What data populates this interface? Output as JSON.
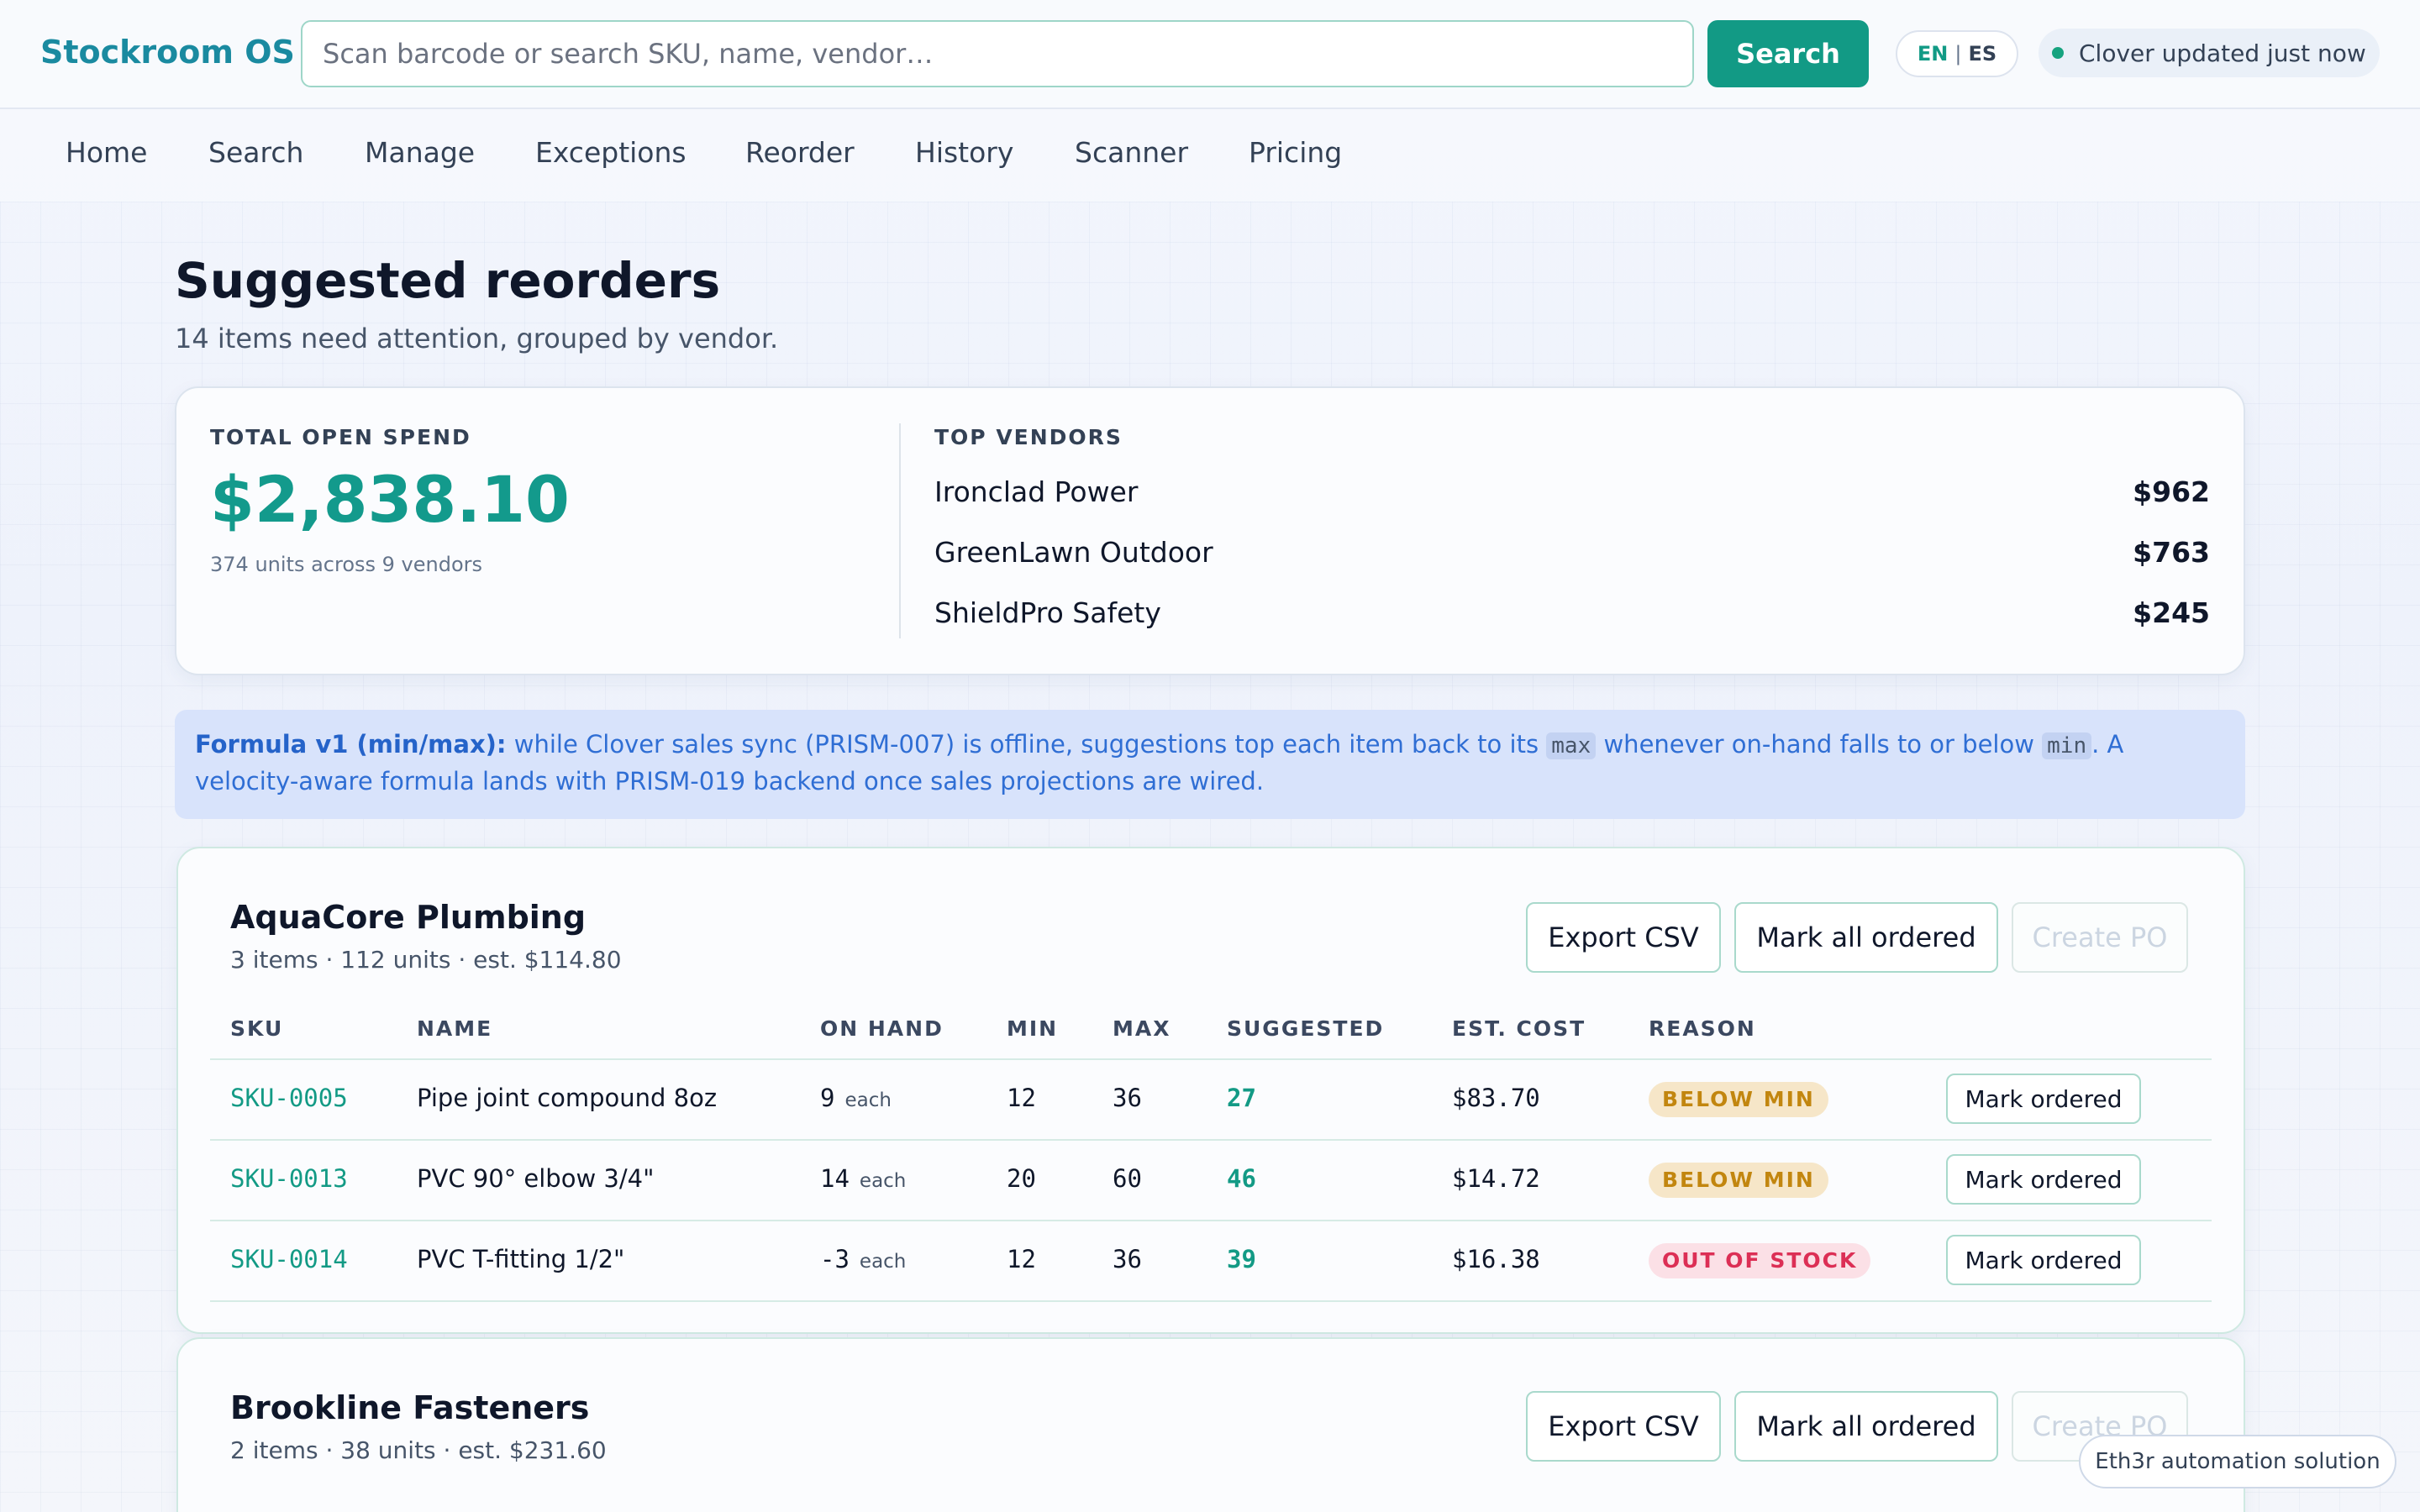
{
  "app": {
    "name": "Stockroom OS"
  },
  "search": {
    "placeholder": "Scan barcode or search SKU, name, vendor…",
    "button_label": "Search"
  },
  "language": {
    "en": "EN",
    "separator": "|",
    "es": "ES"
  },
  "status": {
    "text": "Clover updated just now"
  },
  "nav": [
    "Home",
    "Search",
    "Manage",
    "Exceptions",
    "Reorder",
    "History",
    "Scanner",
    "Pricing"
  ],
  "page": {
    "title": "Suggested reorders",
    "subtitle": "14 items need attention, grouped by vendor."
  },
  "summary": {
    "spend_label": "TOTAL OPEN SPEND",
    "spend_amount": "$2,838.10",
    "units_text": "374 units across 9 vendors",
    "top_vendors_label": "TOP VENDORS",
    "top_vendors": [
      {
        "name": "Ironclad Power",
        "amount": "$962"
      },
      {
        "name": "GreenLawn Outdoor",
        "amount": "$763"
      },
      {
        "name": "ShieldPro Safety",
        "amount": "$245"
      }
    ]
  },
  "banner": {
    "lead": "Formula v1 (min/max):",
    "text1": " while Clover sales sync (PRISM-007) is offline, suggestions top each item back to its ",
    "code1": "max",
    "text2": " whenever on-hand falls to or below ",
    "code2": "min",
    "text3": ". A velocity-aware formula lands with PRISM-019 backend once sales projections are wired."
  },
  "table_headers": [
    "SKU",
    "NAME",
    "ON HAND",
    "MIN",
    "MAX",
    "SUGGESTED",
    "EST. COST",
    "REASON"
  ],
  "actions": {
    "export": "Export CSV",
    "mark_all": "Mark all ordered",
    "create_po": "Create PO",
    "mark_row": "Mark ordered"
  },
  "groups": [
    {
      "vendor": "AquaCore Plumbing",
      "meta": "3 items · 112 units · est. $114.80",
      "rows": [
        {
          "sku": "SKU-0005",
          "name": "Pipe joint compound 8oz",
          "on_hand": "9",
          "unit": "each",
          "min": "12",
          "max": "36",
          "suggested": "27",
          "cost": "$83.70",
          "reason": "BELOW MIN",
          "reason_type": "warn"
        },
        {
          "sku": "SKU-0013",
          "name": "PVC 90° elbow 3/4\"",
          "on_hand": "14",
          "unit": "each",
          "min": "20",
          "max": "60",
          "suggested": "46",
          "cost": "$14.72",
          "reason": "BELOW MIN",
          "reason_type": "warn"
        },
        {
          "sku": "SKU-0014",
          "name": "PVC T-fitting 1/2\"",
          "on_hand": "-3",
          "unit": "each",
          "min": "12",
          "max": "36",
          "suggested": "39",
          "cost": "$16.38",
          "reason": "OUT OF STOCK",
          "reason_type": "out"
        }
      ]
    },
    {
      "vendor": "Brookline Fasteners",
      "meta": "2 items · 38 units · est. $231.60",
      "rows": []
    }
  ],
  "floating_pill": {
    "text": "Eth3r automation solution"
  },
  "colors": {
    "accent": "#129a85",
    "brand": "#1a8aa0",
    "warn": "#c2860f",
    "danger": "#dc2f55",
    "info": "#2f6ed4"
  }
}
